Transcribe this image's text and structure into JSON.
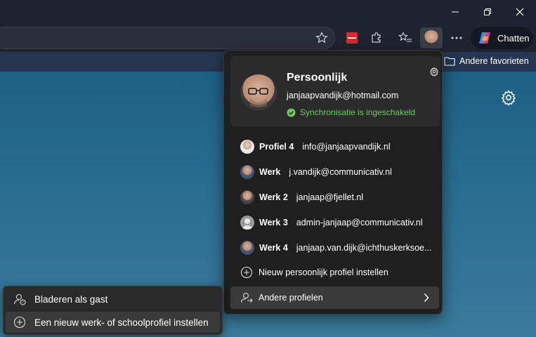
{
  "window": {
    "minimize_icon": "minimize-icon",
    "restore_icon": "restore-icon",
    "close_icon": "close-icon"
  },
  "toolbar": {
    "chat_label": "Chatten"
  },
  "favorites_bar": {
    "other_favorites": "Andere favorieten"
  },
  "profile_card": {
    "name": "Persoonlijk",
    "email": "janjaapvandijk@hotmail.com",
    "sync_status": "Synchronisatie is ingeschakeld",
    "sync_color": "#6ccb5f"
  },
  "profiles": [
    {
      "name": "Profiel 4",
      "email": "info@janjaapvandijk.nl"
    },
    {
      "name": "Werk",
      "email": "j.vandijk@communicativ.nl"
    },
    {
      "name": "Werk 2",
      "email": "janjaap@fjellet.nl"
    },
    {
      "name": "Werk 3",
      "email": "admin-janjaap@communicativ.nl"
    },
    {
      "name": "Werk 4",
      "email": "janjaap.van.dijk@ichthuskerksoe..."
    }
  ],
  "new_personal_profile": "Nieuw persoonlijk profiel instellen",
  "other_profiles": "Andere profielen",
  "guest_menu": {
    "browse_as_guest": "Bladeren als gast",
    "new_work_profile": "Een nieuw werk- of schoolprofiel instellen"
  }
}
